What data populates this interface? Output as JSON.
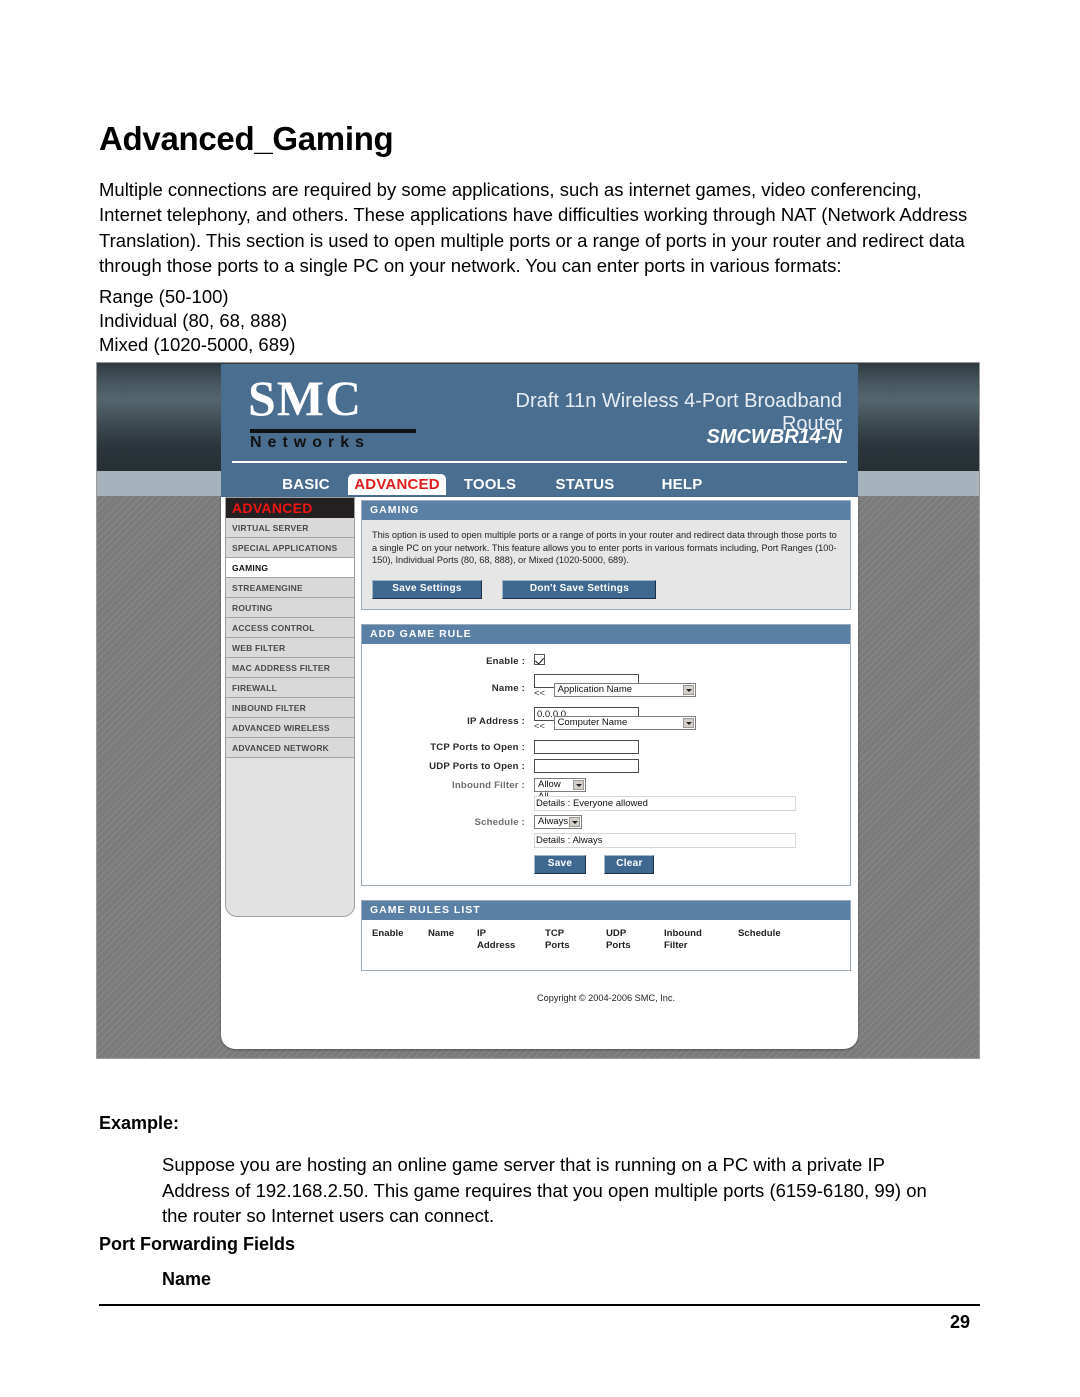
{
  "document": {
    "title": "Advanced_Gaming",
    "intro": "Multiple connections are required by some applications, such as internet games, video conferencing, Internet telephony, and others. These applications have difficulties working through NAT (Network Address Translation). This section is used to open multiple ports or a range of ports in your router and redirect data through those ports to a single PC on your network. You can enter ports in various formats:",
    "formats": [
      "Range (50-100)",
      "Individual (80, 68, 888)",
      "Mixed (1020-5000, 689)"
    ],
    "example_heading": "Example:",
    "example_body": "Suppose you are hosting an online game server that is running on a PC with a private IP Address of 192.168.2.50. This game requires that you open multiple ports (6159-6180, 99) on the router so Internet users can connect.",
    "port_forwarding_heading": "Port Forwarding Fields",
    "port_forwarding_sub": "Name",
    "page_number": "29"
  },
  "router": {
    "brand": "SMC",
    "brand_sub": "Networks",
    "model_line": "Draft 11n Wireless 4-Port Broadband Router",
    "sku": "SMCWBR14-N",
    "nav": [
      {
        "label": "BASIC",
        "active": false
      },
      {
        "label": "ADVANCED",
        "active": true
      },
      {
        "label": "TOOLS",
        "active": false
      },
      {
        "label": "STATUS",
        "active": false
      },
      {
        "label": "HELP",
        "active": false
      }
    ],
    "sidebar": {
      "heading": "ADVANCED",
      "items": [
        {
          "label": "VIRTUAL SERVER",
          "selected": false
        },
        {
          "label": "SPECIAL APPLICATIONS",
          "selected": false
        },
        {
          "label": "GAMING",
          "selected": true
        },
        {
          "label": "STREAMENGINE",
          "selected": false
        },
        {
          "label": "ROUTING",
          "selected": false
        },
        {
          "label": "ACCESS CONTROL",
          "selected": false
        },
        {
          "label": "WEB FILTER",
          "selected": false
        },
        {
          "label": "MAC ADDRESS FILTER",
          "selected": false
        },
        {
          "label": "FIREWALL",
          "selected": false
        },
        {
          "label": "INBOUND FILTER",
          "selected": false
        },
        {
          "label": "ADVANCED WIRELESS",
          "selected": false
        },
        {
          "label": "ADVANCED NETWORK",
          "selected": false
        }
      ]
    },
    "gaming_panel": {
      "title": "GAMING",
      "description": "This option is used to open multiple ports or a range of ports in your router and redirect data through those ports to a single PC on your network. This feature allows you to enter ports in various formats including, Port Ranges (100-150), Individual Ports (80, 68, 888), or Mixed (1020-5000, 689).",
      "save_label": "Save Settings",
      "dont_save_label": "Don't Save Settings"
    },
    "add_game_rule": {
      "title": "ADD GAME RULE",
      "enable_label": "Enable :",
      "enable_checked": true,
      "name_label": "Name :",
      "name_value": "",
      "name_arrows": "<<",
      "app_name_select": "Application Name",
      "ip_label": "IP Address :",
      "ip_value": "0.0.0.0",
      "ip_arrows": "<<",
      "computer_name_select": "Computer Name",
      "tcp_label": "TCP Ports to Open :",
      "tcp_value": "",
      "udp_label": "UDP Ports to Open :",
      "udp_value": "",
      "inbound_label": "Inbound Filter :",
      "inbound_select": "Allow All",
      "inbound_details_label": "Details :",
      "inbound_details_value": "Everyone allowed",
      "schedule_label": "Schedule :",
      "schedule_select": "Always",
      "schedule_details_label": "Details :",
      "schedule_details_value": "Always",
      "save_label": "Save",
      "clear_label": "Clear"
    },
    "game_rules_list": {
      "title": "GAME RULES LIST",
      "columns": [
        "Enable",
        "Name",
        "IP\nAddress",
        "TCP\nPorts",
        "UDP\nPorts",
        "Inbound\nFilter",
        "Schedule"
      ],
      "col_enable": "Enable",
      "col_name": "Name",
      "col_ip_1": "IP",
      "col_ip_2": "Address",
      "col_tcp_1": "TCP",
      "col_tcp_2": "Ports",
      "col_udp_1": "UDP",
      "col_udp_2": "Ports",
      "col_inbound_1": "Inbound",
      "col_inbound_2": "Filter",
      "col_schedule": "Schedule",
      "rows": []
    },
    "copyright": "Copyright © 2004-2006 SMC, Inc."
  },
  "colors": {
    "header_blue": "#4a6e90",
    "panel_blue": "#5b80a6",
    "accent_red": "#e01b1b",
    "button_blue": "#3f6891"
  }
}
